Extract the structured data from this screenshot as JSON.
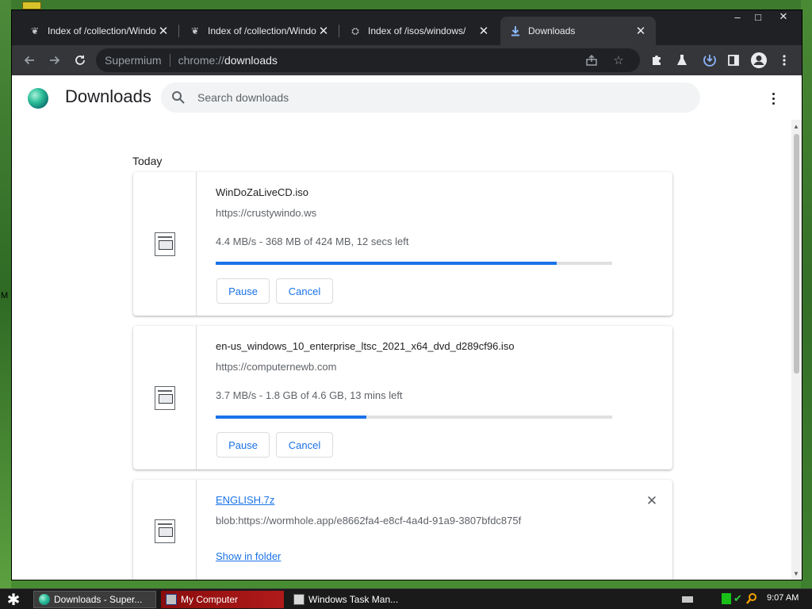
{
  "window": {
    "tabs": [
      {
        "title": "Index of /collection/Windows",
        "active": false
      },
      {
        "title": "Index of /collection/Windows",
        "active": false
      },
      {
        "title": "Index of /isos/windows/",
        "active": false
      },
      {
        "title": "Downloads",
        "active": true
      }
    ],
    "controls": {
      "minimize": "–",
      "maximize": "□",
      "close": "✕"
    }
  },
  "toolbar": {
    "browser_name": "Supermium",
    "url_scheme": "chrome://",
    "url_host": "downloads"
  },
  "page": {
    "title": "Downloads",
    "search_placeholder": "Search downloads",
    "section_label": "Today",
    "accent_color": "#1a73e8"
  },
  "downloads": [
    {
      "filename": "WinDoZaLiveCD.iso",
      "source": "https://crustywindo.ws",
      "status": "4.4 MB/s - 368 MB of 424 MB, 12 secs left",
      "progress_percent": 86,
      "pause_label": "Pause",
      "cancel_label": "Cancel"
    },
    {
      "filename": "en-us_windows_10_enterprise_ltsc_2021_x64_dvd_d289cf96.iso",
      "source": "https://computernewb.com",
      "status": "3.7 MB/s - 1.8 GB of 4.6 GB, 13 mins left",
      "progress_percent": 38,
      "pause_label": "Pause",
      "cancel_label": "Cancel"
    },
    {
      "filename": "ENGLISH.7z",
      "source": "blob:https://wormhole.app/e8662fa4-e8cf-4a4d-91a9-3807bfdc875f",
      "show_in_folder_label": "Show in folder"
    }
  ],
  "taskbar": {
    "items": [
      {
        "label": "Downloads - Super...",
        "active": true
      },
      {
        "label": "My Computer",
        "active": false
      },
      {
        "label": "Windows Task Man...",
        "active": false
      }
    ],
    "clock": "9:07 AM"
  },
  "desktop": {
    "edge_label": "M"
  }
}
